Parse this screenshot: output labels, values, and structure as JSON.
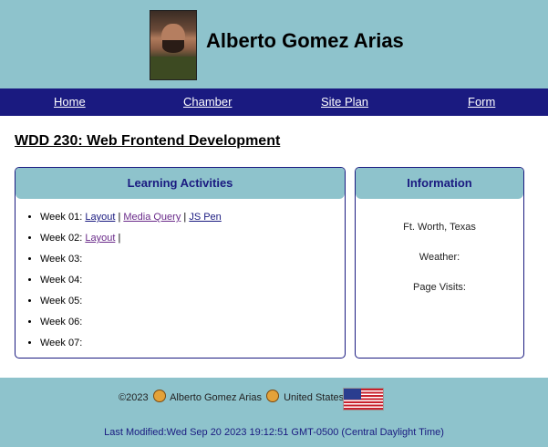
{
  "header": {
    "site_title": "Alberto Gomez Arias",
    "avatar_alt": "Alberto Gomez Arias photo"
  },
  "nav": {
    "items": [
      {
        "label": "Home"
      },
      {
        "label": "Chamber"
      },
      {
        "label": "Site Plan"
      },
      {
        "label": "Form"
      }
    ]
  },
  "main": {
    "heading": "WDD 230: Web Frontend Development",
    "activities": {
      "title": "Learning Activities",
      "weeks": [
        {
          "label": "Week 01:",
          "links": [
            "Layout",
            "Media Query",
            "JS Pen"
          ],
          "separator": "|"
        },
        {
          "label": "Week 02:",
          "links": [
            "Layout"
          ],
          "separator": "|"
        },
        {
          "label": "Week 03:"
        },
        {
          "label": "Week 04:"
        },
        {
          "label": "Week 05:"
        },
        {
          "label": "Week 06:"
        },
        {
          "label": "Week 07:"
        }
      ]
    },
    "information": {
      "title": "Information",
      "location": "Ft. Worth, Texas",
      "weather_label": "Weather:",
      "visits_label": "Page Visits:"
    }
  },
  "footer": {
    "copyright_year": "©2023",
    "author": "Alberto Gomez Arias",
    "country": "United States",
    "last_modified": "Last Modified:Wed Sep 20 2023 19:12:51 GMT-0500 (Central Daylight Time)"
  },
  "colors": {
    "header_bg": "#8ec3cc",
    "nav_bg": "#1a1a80",
    "accent": "#1a1a80"
  }
}
